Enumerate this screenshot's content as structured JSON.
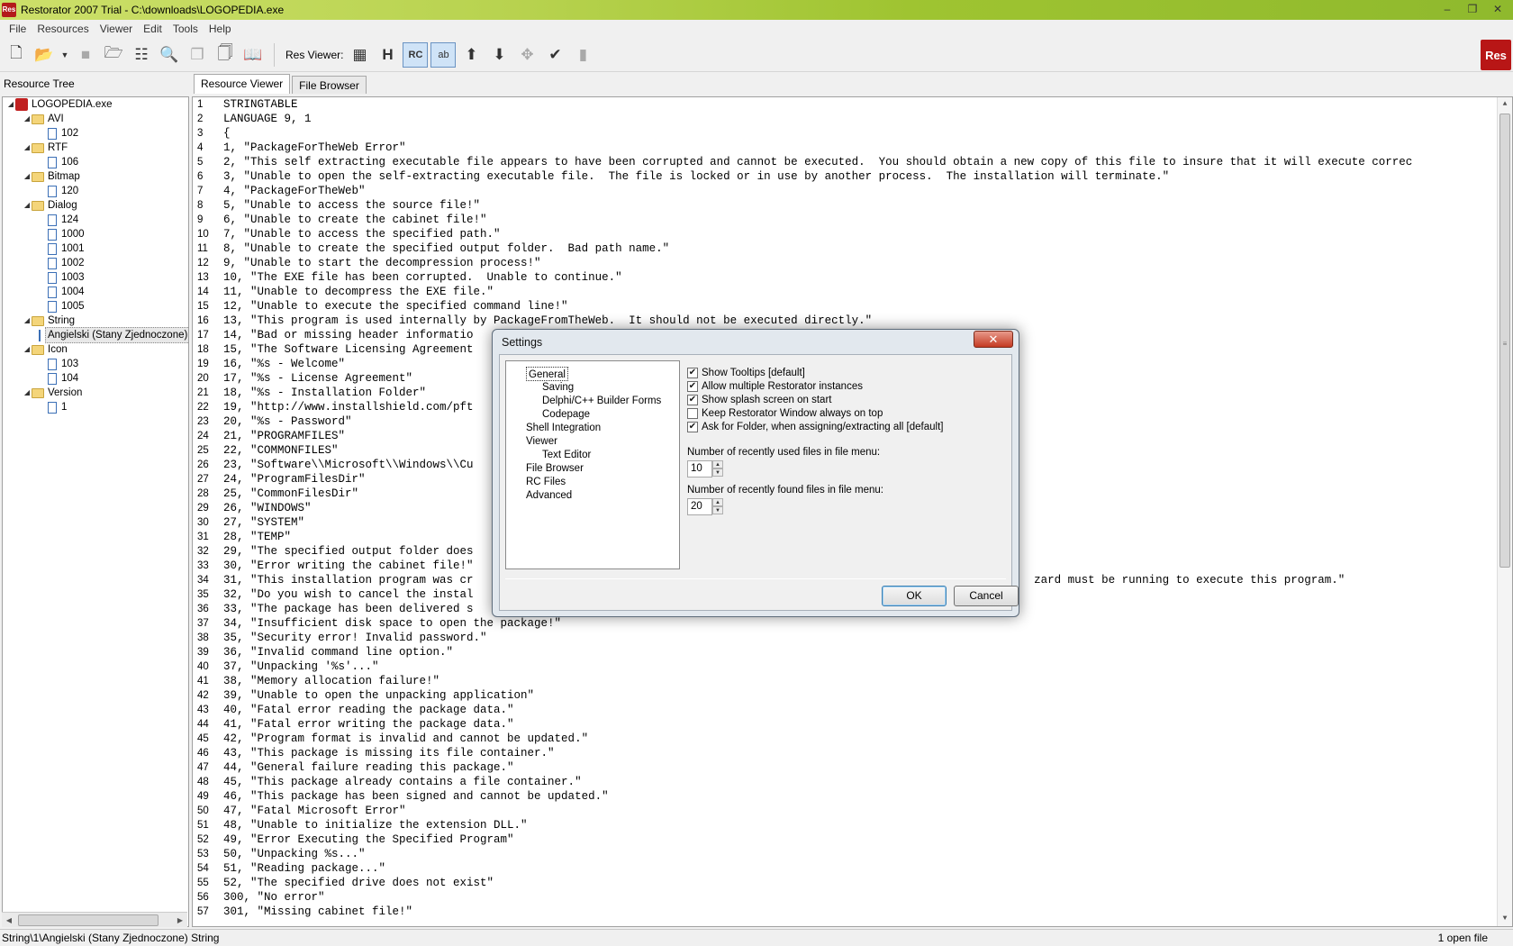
{
  "window": {
    "title": "Restorator 2007 Trial - C:\\downloads\\LOGOPEDIA.exe",
    "app_icon_text": "Res"
  },
  "menu": [
    "File",
    "Resources",
    "Viewer",
    "Edit",
    "Tools",
    "Help"
  ],
  "toolbar": {
    "res_viewer_label": "Res Viewer:",
    "logo_text": "Res"
  },
  "left_pane": {
    "title": "Resource Tree",
    "tree": [
      {
        "level": 0,
        "type": "root",
        "label": "LOGOPEDIA.exe"
      },
      {
        "level": 1,
        "type": "folder",
        "label": "AVI"
      },
      {
        "level": 2,
        "type": "file",
        "label": "102"
      },
      {
        "level": 1,
        "type": "folder",
        "label": "RTF"
      },
      {
        "level": 2,
        "type": "file",
        "label": "106"
      },
      {
        "level": 1,
        "type": "folder",
        "label": "Bitmap"
      },
      {
        "level": 2,
        "type": "file",
        "label": "120"
      },
      {
        "level": 1,
        "type": "folder",
        "label": "Dialog"
      },
      {
        "level": 2,
        "type": "file",
        "label": "124"
      },
      {
        "level": 2,
        "type": "file",
        "label": "1000"
      },
      {
        "level": 2,
        "type": "file",
        "label": "1001"
      },
      {
        "level": 2,
        "type": "file",
        "label": "1002"
      },
      {
        "level": 2,
        "type": "file",
        "label": "1003"
      },
      {
        "level": 2,
        "type": "file",
        "label": "1004"
      },
      {
        "level": 2,
        "type": "file",
        "label": "1005"
      },
      {
        "level": 1,
        "type": "folder",
        "label": "String"
      },
      {
        "level": 2,
        "type": "file",
        "label": "Angielski (Stany Zjednoczone)",
        "selected": true
      },
      {
        "level": 1,
        "type": "folder",
        "label": "Icon"
      },
      {
        "level": 2,
        "type": "file",
        "label": "103"
      },
      {
        "level": 2,
        "type": "file",
        "label": "104"
      },
      {
        "level": 1,
        "type": "folder",
        "label": "Version"
      },
      {
        "level": 2,
        "type": "file",
        "label": "1"
      }
    ]
  },
  "tabs": {
    "resource_viewer": "Resource Viewer",
    "file_browser": "File Browser"
  },
  "editor": {
    "lines": [
      "STRINGTABLE",
      "LANGUAGE 9, 1",
      "{",
      "1, \"PackageForTheWeb Error\"",
      "2, \"This self extracting executable file appears to have been corrupted and cannot be executed.  You should obtain a new copy of this file to insure that it will execute correc",
      "3, \"Unable to open the self-extracting executable file.  The file is locked or in use by another process.  The installation will terminate.\"",
      "4, \"PackageForTheWeb\"",
      "5, \"Unable to access the source file!\"",
      "6, \"Unable to create the cabinet file!\"",
      "7, \"Unable to access the specified path.\"",
      "8, \"Unable to create the specified output folder.  Bad path name.\"",
      "9, \"Unable to start the decompression process!\"",
      "10, \"The EXE file has been corrupted.  Unable to continue.\"",
      "11, \"Unable to decompress the EXE file.\"",
      "12, \"Unable to execute the specified command line!\"",
      "13, \"This program is used internally by PackageFromTheWeb.  It should not be executed directly.\"",
      "14, \"Bad or missing header informatio",
      "15, \"The Software Licensing Agreement",
      "16, \"%s - Welcome\"",
      "17, \"%s - License Agreement\"",
      "18, \"%s - Installation Folder\"",
      "19, \"http://www.installshield.com/pft",
      "20, \"%s - Password\"",
      "21, \"PROGRAMFILES\"",
      "22, \"COMMONFILES\"",
      "23, \"Software\\\\Microsoft\\\\Windows\\\\Cu",
      "24, \"ProgramFilesDir\"",
      "25, \"CommonFilesDir\"",
      "26, \"WINDOWS\"",
      "27, \"SYSTEM\"",
      "28, \"TEMP\"",
      "29, \"The specified output folder does",
      "30, \"Error writing the cabinet file!\"",
      "31, \"This installation program was cr                                                                                   zard must be running to execute this program.\"",
      "32, \"Do you wish to cancel the instal",
      "33, \"The package has been delivered s",
      "34, \"Insufficient disk space to open the package!\"",
      "35, \"Security error! Invalid password.\"",
      "36, \"Invalid command line option.\"",
      "37, \"Unpacking '%s'...\"",
      "38, \"Memory allocation failure!\"",
      "39, \"Unable to open the unpacking application\"",
      "40, \"Fatal error reading the package data.\"",
      "41, \"Fatal error writing the package data.\"",
      "42, \"Program format is invalid and cannot be updated.\"",
      "43, \"This package is missing its file container.\"",
      "44, \"General failure reading this package.\"",
      "45, \"This package already contains a file container.\"",
      "46, \"This package has been signed and cannot be updated.\"",
      "47, \"Fatal Microsoft Error\"",
      "48, \"Unable to initialize the extension DLL.\"",
      "49, \"Error Executing the Specified Program\"",
      "50, \"Unpacking %s...\"",
      "51, \"Reading package...\"",
      "52, \"The specified drive does not exist\"",
      "300, \"No error\"",
      "301, \"Missing cabinet file!\""
    ]
  },
  "status": {
    "left": "String\\1\\Angielski (Stany Zjednoczone)  String",
    "right": "1 open file"
  },
  "dialog": {
    "title": "Settings",
    "close_label": "✕",
    "tree": [
      {
        "label": "General",
        "indent": 0,
        "selected": true
      },
      {
        "label": "Saving",
        "indent": 1
      },
      {
        "label": "Delphi/C++ Builder Forms",
        "indent": 1
      },
      {
        "label": "Codepage",
        "indent": 1
      },
      {
        "label": "Shell Integration",
        "indent": 0
      },
      {
        "label": "Viewer",
        "indent": 0
      },
      {
        "label": "Text Editor",
        "indent": 1
      },
      {
        "label": "File Browser",
        "indent": 0
      },
      {
        "label": "RC Files",
        "indent": 0
      },
      {
        "label": "Advanced",
        "indent": 0
      }
    ],
    "options": [
      {
        "label": "Show Tooltips [default]",
        "checked": true
      },
      {
        "label": "Allow multiple Restorator instances",
        "checked": true
      },
      {
        "label": "Show splash screen on start",
        "checked": true
      },
      {
        "label": "Keep Restorator Window always on top",
        "checked": false
      },
      {
        "label": "Ask for Folder, when assigning/extracting all [default]",
        "checked": true
      }
    ],
    "recent_used": {
      "label": "Number of recently used files in file menu:",
      "value": "10"
    },
    "recent_found": {
      "label": "Number of recently found files in file menu:",
      "value": "20"
    },
    "ok_label": "OK",
    "cancel_label": "Cancel"
  }
}
